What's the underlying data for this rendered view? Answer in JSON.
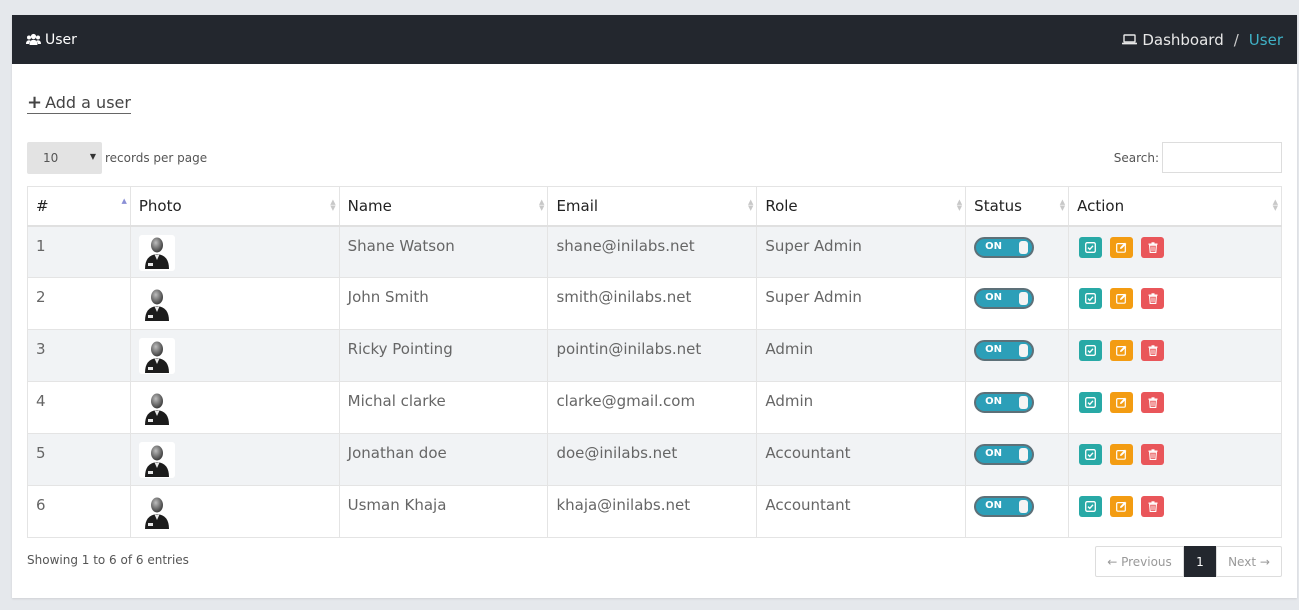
{
  "header": {
    "title": "User",
    "breadcrumb": {
      "home": "Dashboard",
      "separator": "/",
      "current": "User"
    }
  },
  "add_user": {
    "plus": "+",
    "label": "Add a user"
  },
  "length": {
    "value": "10",
    "label": "records per page"
  },
  "search": {
    "label": "Search:",
    "value": ""
  },
  "columns": [
    "#",
    "Photo",
    "Name",
    "Email",
    "Role",
    "Status",
    "Action"
  ],
  "rows": [
    {
      "num": "1",
      "name": "Shane Watson",
      "email": "shane@inilabs.net",
      "role": "Super Admin",
      "status": "ON"
    },
    {
      "num": "2",
      "name": "John Smith",
      "email": "smith@inilabs.net",
      "role": "Super Admin",
      "status": "ON"
    },
    {
      "num": "3",
      "name": "Ricky Pointing",
      "email": "pointin@inilabs.net",
      "role": "Admin",
      "status": "ON"
    },
    {
      "num": "4",
      "name": "Michal clarke",
      "email": "clarke@gmail.com",
      "role": "Admin",
      "status": "ON"
    },
    {
      "num": "5",
      "name": "Jonathan doe",
      "email": "doe@inilabs.net",
      "role": "Accountant",
      "status": "ON"
    },
    {
      "num": "6",
      "name": "Usman Khaja",
      "email": "khaja@inilabs.net",
      "role": "Accountant",
      "status": "ON"
    }
  ],
  "footer": {
    "info": "Showing 1 to 6 of 6 entries",
    "prev": "← Previous",
    "page": "1",
    "next": "Next →"
  },
  "icons": {
    "title": "users-icon",
    "home": "laptop-icon",
    "view": "check-square-icon",
    "edit": "edit-icon",
    "delete": "trash-icon",
    "photo": "user-avatar-icon"
  },
  "colors": {
    "topbar": "#23272e",
    "accent": "#3fb1c6",
    "view": "#28a9a6",
    "edit": "#f39c12",
    "delete": "#e9565a",
    "toggle": "#2c9fb8"
  }
}
